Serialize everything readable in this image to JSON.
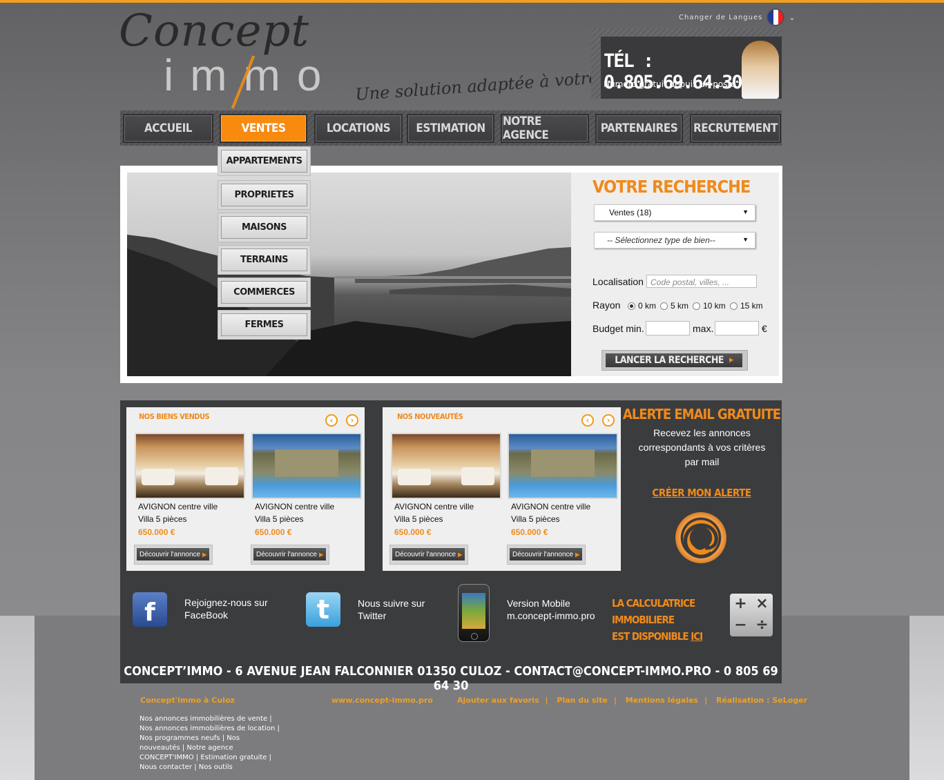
{
  "header": {
    "logo_word1": "Concept",
    "logo_word2": "immo",
    "tagline": "Une solution adaptée à votre projet",
    "lang_label": "Changer de Langues",
    "phone_title": "TÉL : 0.805.69.64.30",
    "phone_sub": "Numéro gratuit depuis un poste fixe"
  },
  "nav": [
    "ACCUEIL",
    "VENTES",
    "LOCATIONS",
    "ESTIMATION",
    "NOTRE AGENCE",
    "PARTENAIRES",
    "RECRUTEMENT"
  ],
  "nav_active": "VENTES",
  "dropdown": [
    "APPARTEMENTS",
    "PROPRIETES",
    "MAISONS",
    "TERRAINS",
    "COMMERCES",
    "FERMES"
  ],
  "search": {
    "title": "VOTRE RECHERCHE",
    "select1": "Ventes (18)",
    "select2": "-- Sélectionnez type de bien--",
    "loc_label": "Localisation",
    "loc_placeholder": "Code postal, villes, ...",
    "rayon_label": "Rayon",
    "rayon_options": [
      "0 km",
      "5 km",
      "10 km",
      "15 km"
    ],
    "rayon_selected": "0 km",
    "budget_min": "Budget min.",
    "budget_max": "max.",
    "currency": "€",
    "button": "LANCER LA RECHERCHE"
  },
  "sold": {
    "title": "NOS BIENS VENDUS",
    "items": [
      {
        "town": "AVIGNON",
        "area": "centre ville",
        "type": "Villa 5 pièces",
        "price": "650.000 €",
        "button": "Découvrir l'annonce"
      },
      {
        "town": "AVIGNON",
        "area": "centre ville",
        "type": "Villa 5 pièces",
        "price": "650.000 €",
        "button": "Découvrir l'annonce"
      }
    ]
  },
  "news": {
    "title": "NOS NOUVEAUTÉS",
    "items": [
      {
        "town": "AVIGNON",
        "area": "centre ville",
        "type": "Villa 5 pièces",
        "price": "650.000 €",
        "button": "Découvrir l'annonce"
      },
      {
        "town": "AVIGNON",
        "area": "centre ville",
        "type": "Villa 5 pièces",
        "price": "650.000 €",
        "button": "Découvrir l'annonce"
      }
    ]
  },
  "alert": {
    "title": "ALERTE EMAIL GRATUITE",
    "desc": "Recevez les annonces correspondants à vos critères par mail",
    "cta": "CRÉER MON ALERTE"
  },
  "social": {
    "facebook": "Rejoignez-nous sur FaceBook",
    "twitter": "Nous suivre sur Twitter",
    "mobile_line1": "Version Mobile",
    "mobile_line2": "m.concept-immo.pro",
    "calc_line1": "LA CALCULATRICE IMMOBILIERE",
    "calc_line2": "EST DISPONIBLE",
    "calc_link": "ICI"
  },
  "address": "CONCEPT’IMMO - 6 AVENUE JEAN FALCONNIER 01350 CULOZ - CONTACT@CONCEPT-IMMO.PRO - 0 805 69 64 30",
  "footer": {
    "agency": "Concept'immo à Culoz",
    "site": "www.concept-immo.pro",
    "links": [
      "Ajouter aux favoris",
      "Plan du site",
      "Mentions légales",
      "Réalisation : SeLoger"
    ],
    "nav_text": "Nos annonces immobilières de vente | Nos annonces immobilières de location | Nos programmes neufs | Nos nouveautés | Notre agence CONCEPT'IMMO | Estimation gratuite | Nous contacter | Nos outils"
  },
  "colors": {
    "accent": "#f08a1a",
    "dark_panel": "#3b3c3e",
    "top_line": "#f0a020"
  },
  "icons": [
    "french-flag-icon",
    "facebook-icon",
    "twitter-icon",
    "mobile-phone-icon",
    "calculator-icon",
    "at-sign-icon",
    "arrow-left-icon",
    "arrow-right-icon"
  ]
}
